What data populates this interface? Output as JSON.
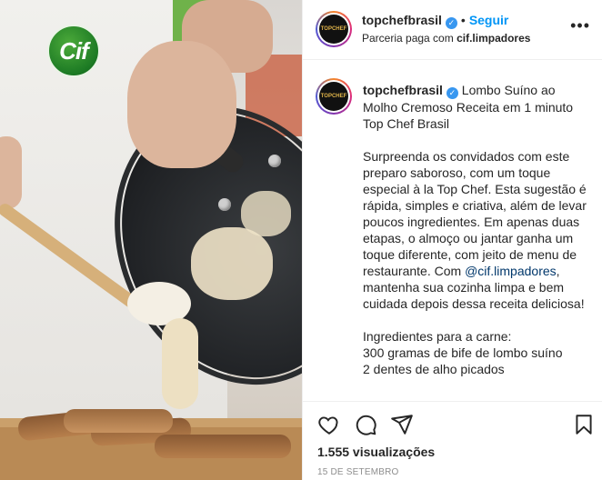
{
  "media": {
    "brand_logo_text": "Cif"
  },
  "header": {
    "avatar_text": "TOPCHEF",
    "username": "topchefbrasil",
    "separator": "•",
    "follow_label": "Seguir",
    "partnership_prefix": "Parceria paga com ",
    "partner": "cif.limpadores",
    "more_label": "•••"
  },
  "caption": {
    "avatar_text": "TOPCHEF",
    "username": "topchefbrasil",
    "title": "Lombo Suíno ao Molho Cremoso Receita em 1 minuto Top Chef Brasil",
    "body_before_mention": "Surpreenda os convidados com este preparo saboroso, com um toque especial à la Top Chef. Esta sugestão é rápida, simples e criativa, além de levar poucos ingredientes. Em apenas duas etapas, o almoço ou jantar ganha um toque diferente, com jeito de menu de restaurante. Com ",
    "mention": "@cif.limpadores",
    "body_after_mention": ", mantenha sua cozinha limpa e bem cuidada depois dessa receita deliciosa!",
    "ingredients_heading": "Ingredientes para a carne:",
    "ingredients": [
      "300 gramas de bife de lombo suíno",
      "2 dentes de alho picados"
    ]
  },
  "footer": {
    "views": "1.555 visualizações",
    "date": "15 DE SETEMBRO"
  },
  "colors": {
    "accent": "#0095f6",
    "verified": "#3897f0",
    "mention": "#00376b",
    "muted": "#8e8e8e"
  }
}
